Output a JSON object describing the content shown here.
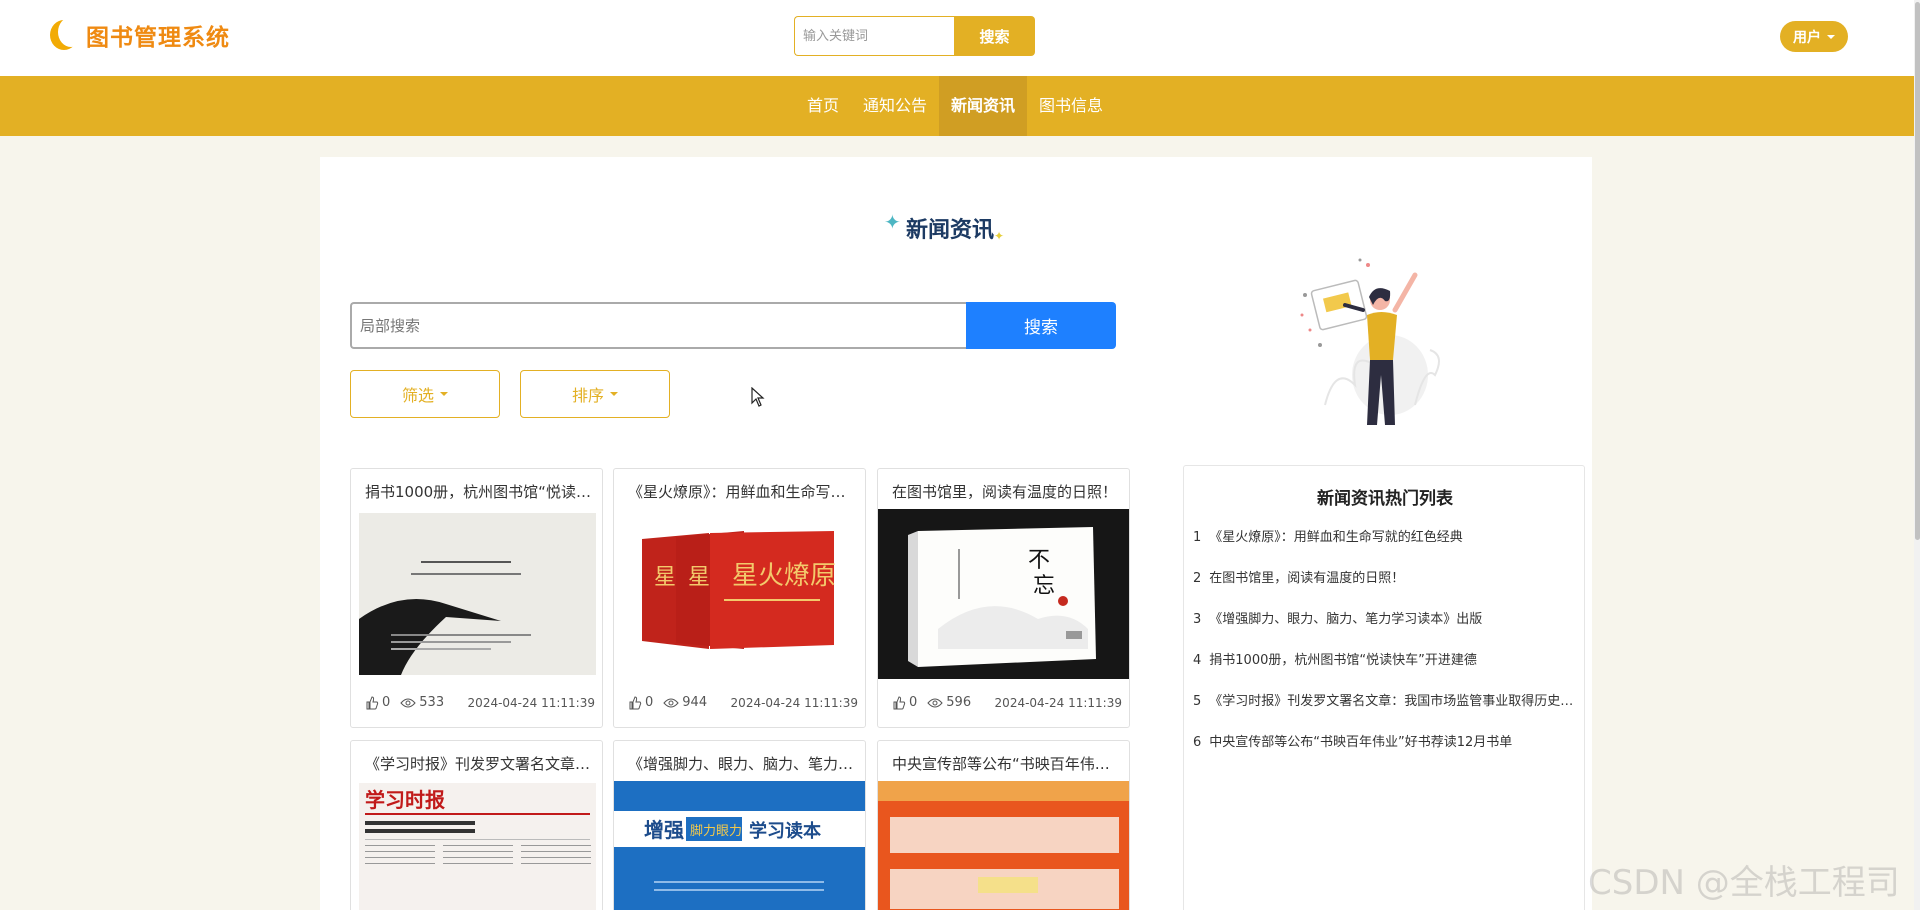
{
  "header": {
    "app_title": "图书管理系统",
    "search_placeholder": "输入关键词",
    "search_button": "搜索",
    "user_button": "用户"
  },
  "nav": {
    "items": [
      {
        "label": "首页"
      },
      {
        "label": "通知公告"
      },
      {
        "label": "新闻资讯"
      },
      {
        "label": "图书信息"
      }
    ],
    "active": "新闻资讯"
  },
  "page": {
    "title": "新闻资讯",
    "local_search_placeholder": "局部搜索",
    "local_search_button": "搜索",
    "filter_label": "筛选",
    "sort_label": "排序"
  },
  "cards": [
    {
      "title": "捐书1000册，杭州图书馆“悦读快车”开进建德",
      "likes": "0",
      "views": "533",
      "date": "2024-04-24 11:11:39",
      "image": "book-cover-white"
    },
    {
      "title": "《星火燎原》：用鲜血和生命写就的红色经典",
      "likes": "0",
      "views": "944",
      "date": "2024-04-24 11:11:39",
      "image": "red-books"
    },
    {
      "title": "在图书馆里，阅读有温度的日照！",
      "likes": "0",
      "views": "596",
      "date": "2024-04-24 11:11:39",
      "image": "bu-wang-chu-xin-book"
    },
    {
      "title": "《学习时报》刊发罗文署名文章：我国市场监管事业取得历史性成就",
      "likes": "",
      "views": "",
      "date": "",
      "image": "newspaper"
    },
    {
      "title": "《增强脚力、眼力、脑力、笔力学习读本》出版",
      "likes": "",
      "views": "",
      "date": "",
      "image": "blue-book"
    },
    {
      "title": "中央宣传部等公布“书映百年伟业”好书荐读12月书单",
      "likes": "",
      "views": "",
      "date": "",
      "image": "red-banner"
    }
  ],
  "hot_list": {
    "title": "新闻资讯热门列表",
    "items": [
      {
        "rank": "1",
        "text": "《星火燎原》：用鲜血和生命写就的红色经典"
      },
      {
        "rank": "2",
        "text": "在图书馆里，阅读有温度的日照！"
      },
      {
        "rank": "3",
        "text": "《增强脚力、眼力、脑力、笔力学习读本》出版"
      },
      {
        "rank": "4",
        "text": "捐书1000册，杭州图书馆“悦读快车”开进建德"
      },
      {
        "rank": "5",
        "text": "《学习时报》刊发罗文署名文章：我国市场监管事业取得历史性成就"
      },
      {
        "rank": "6",
        "text": "中央宣传部等公布“书映百年伟业”好书荐读12月书单"
      }
    ]
  },
  "watermark": "CSDN @全栈工程司",
  "colors": {
    "accent": "#e3b024",
    "nav_active": "#d09e23",
    "primary_button": "#1e80ff",
    "logo_text": "#ef8a12",
    "page_background": "#f7f5ec"
  }
}
